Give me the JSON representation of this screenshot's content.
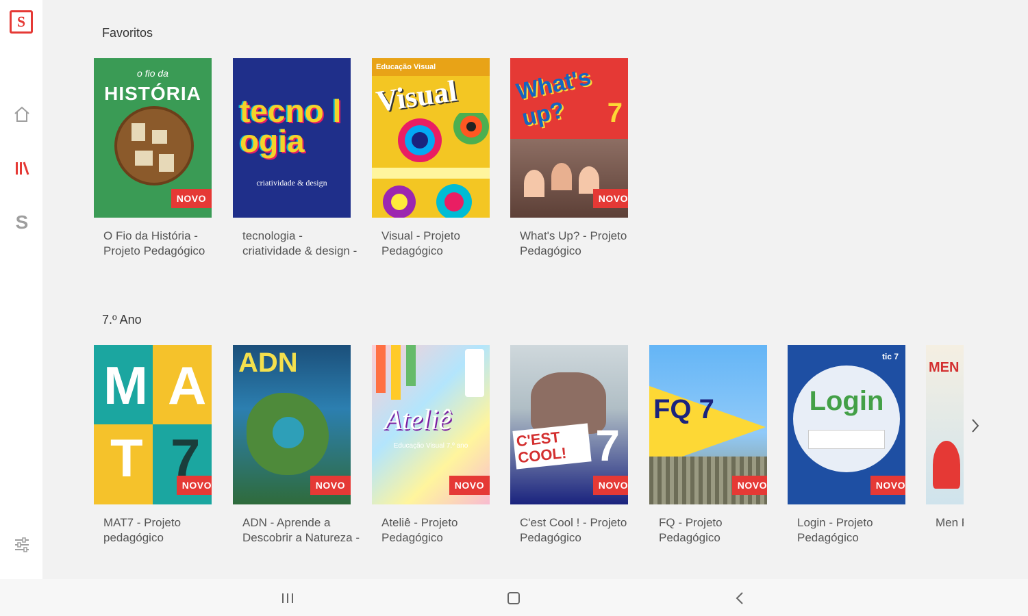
{
  "app": {
    "logo_letter": "S",
    "brand_color": "#e53935"
  },
  "sidebar": {
    "items": [
      {
        "name": "home",
        "icon": "home-icon"
      },
      {
        "name": "library",
        "icon": "library-icon",
        "active": true
      },
      {
        "name": "s",
        "icon": "s-letter-icon",
        "label": "S"
      },
      {
        "name": "filter",
        "icon": "filter-icon"
      }
    ]
  },
  "sections": [
    {
      "title": "Favoritos",
      "books": [
        {
          "title": "O Fio da História - Projeto Pedagógico",
          "badge": "NOVO",
          "cover_text": "HISTÓRIA",
          "cover_sub": "o fio da"
        },
        {
          "title": "tecnologia - criatividade & design - Projeto Pedagógico",
          "badge": "",
          "cover_text": "tecno logia",
          "cover_sub": "criatividade & design"
        },
        {
          "title": "Visual - Projeto Pedagógico",
          "badge": "",
          "cover_text": "Visual",
          "cover_sub": "Educação Visual"
        },
        {
          "title": "What's Up? - Projeto Pedagógico",
          "badge": "NOVO",
          "cover_text": "What's up?",
          "cover_sub": "7"
        }
      ]
    },
    {
      "title": "7.º Ano",
      "books": [
        {
          "title": "MAT7 - Projeto pedagógico",
          "badge": "NOVO",
          "cover_text": "MAT7",
          "cover_sub": ""
        },
        {
          "title": "ADN - Aprende a Descobrir a Natureza - Projeto Pedagógico",
          "badge": "NOVO",
          "cover_text": "ADN",
          "cover_sub": ""
        },
        {
          "title": "Ateliê - Projeto Pedagógico",
          "badge": "NOVO",
          "cover_text": "Ateliê",
          "cover_sub": "Educação Visual 7.º ano"
        },
        {
          "title": "C'est Cool ! - Projeto Pedagógico",
          "badge": "NOVO",
          "cover_text": "C'EST COOL!",
          "cover_sub": "7"
        },
        {
          "title": "FQ - Projeto Pedagógico",
          "badge": "NOVO",
          "cover_text": "FQ 7",
          "cover_sub": ""
        },
        {
          "title": "Login - Projeto Pedagógico",
          "badge": "NOVO",
          "cover_text": "Login",
          "cover_sub": "tic 7"
        },
        {
          "title": "Men Pedagógico",
          "badge": "",
          "cover_text": "MEN",
          "cover_sub": ""
        }
      ]
    }
  ],
  "system_nav": {
    "recents": "recents-icon",
    "home": "home-square-icon",
    "back": "back-icon"
  }
}
